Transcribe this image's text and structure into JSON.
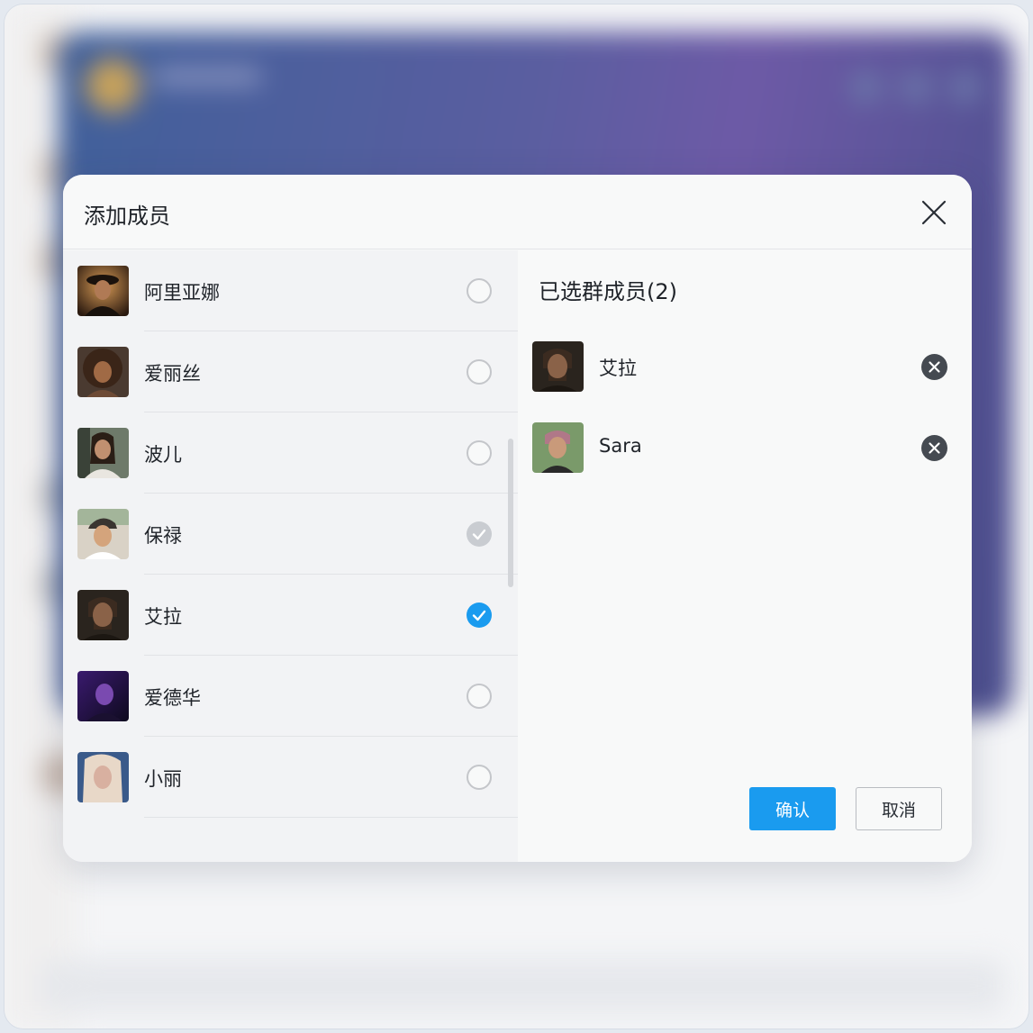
{
  "dialog": {
    "title": "添加成员",
    "close_icon": "close-icon"
  },
  "contacts": [
    {
      "name": "阿里亚娜",
      "state": "unchecked"
    },
    {
      "name": "爱丽丝",
      "state": "unchecked"
    },
    {
      "name": "波儿",
      "state": "unchecked"
    },
    {
      "name": "保禄",
      "state": "disabled-checked"
    },
    {
      "name": "艾拉",
      "state": "checked"
    },
    {
      "name": "爱德华",
      "state": "unchecked"
    },
    {
      "name": "小丽",
      "state": "unchecked"
    }
  ],
  "selected": {
    "title": "已选群成员(2)",
    "items": [
      {
        "name": "艾拉"
      },
      {
        "name": "Sara"
      }
    ]
  },
  "buttons": {
    "confirm": "确认",
    "cancel": "取消"
  },
  "colors": {
    "accent": "#1a9bef",
    "remove_button": "#454a51",
    "disabled_check": "#c9ccd1"
  }
}
